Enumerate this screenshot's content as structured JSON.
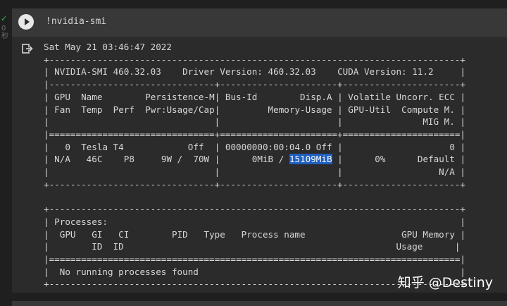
{
  "gutter": {
    "status_mark": "✓",
    "exec_count": "0\n秒"
  },
  "cell": {
    "code": "!nvidia-smi"
  },
  "output": {
    "datetime": "Sat May 21 03:46:47 2022",
    "smi_header": {
      "smi_version": "460.32.03",
      "driver_version": "460.32.03",
      "cuda_version": "11.2"
    },
    "gpu_columns": {
      "row1": [
        "GPU",
        "Name",
        "Persistence-M",
        "Bus-Id",
        "Disp.A",
        "Volatile Uncorr. ECC"
      ],
      "row2": [
        "Fan",
        "Temp",
        "Perf",
        "Pwr:Usage/Cap",
        "Memory-Usage",
        "GPU-Util",
        "Compute M."
      ],
      "row3": [
        "MIG M."
      ]
    },
    "gpu": {
      "index": "0",
      "name": "Tesla T4",
      "persistence": "Off",
      "bus_id": "00000000:00:04.0",
      "disp": "Off",
      "ecc": "0",
      "fan": "N/A",
      "temp": "46C",
      "perf": "P8",
      "pwr_usage": "9W",
      "pwr_cap": "70W",
      "mem_used": "0MiB",
      "mem_total": "15109MiB",
      "gpu_util": "0%",
      "compute_mode": "Default",
      "mig_mode": "N/A"
    },
    "processes": {
      "title": "Processes:",
      "columns_row1": [
        "GPU",
        "GI",
        "CI",
        "PID",
        "Type",
        "Process name",
        "GPU Memory"
      ],
      "columns_row2": [
        "ID",
        "ID",
        "Usage"
      ],
      "empty_message": "No running processes found"
    }
  },
  "watermark": "知乎 @Destiny"
}
